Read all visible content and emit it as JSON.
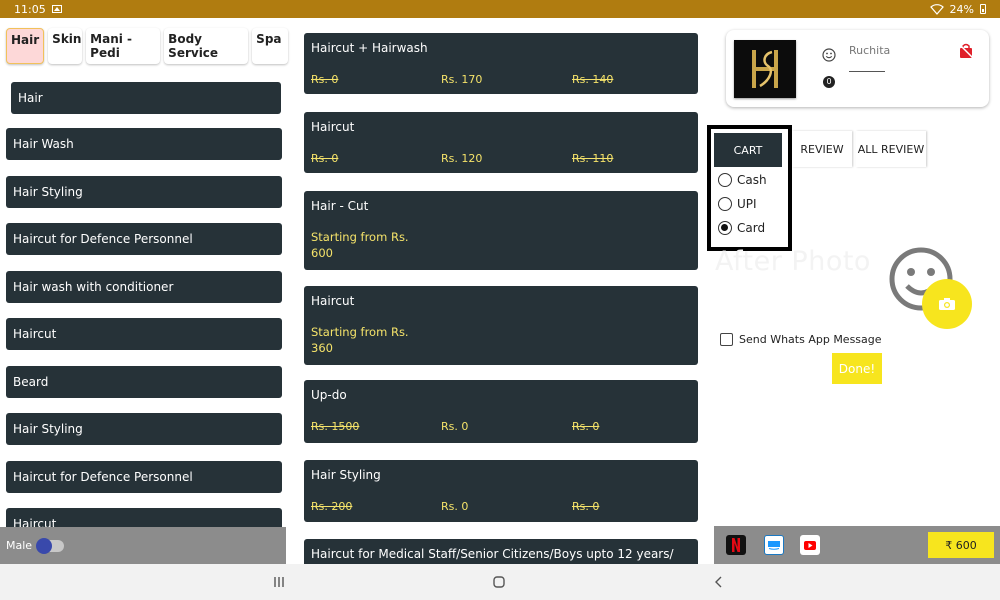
{
  "status": {
    "time": "11:05",
    "battery": "24%"
  },
  "categories": [
    "Hair",
    "Skin",
    "Mani - Pedi",
    "Body Service",
    "Spa"
  ],
  "services": [
    "Hair",
    "Hair Wash",
    "Hair Styling",
    "Haircut for Defence Personnel",
    "Hair wash with conditioner",
    "Haircut",
    "Beard",
    "Hair Styling",
    "Haircut for Defence Personnel",
    "Haircut"
  ],
  "gender_label": "Male",
  "cards": [
    {
      "title": "Haircut + Hairwash",
      "p1": "Rs. 0",
      "p2": "Rs. 170",
      "p3": "Rs. 140"
    },
    {
      "title": "Haircut",
      "p1": "Rs. 0",
      "p2": "Rs. 120",
      "p3": "Rs. 110"
    },
    {
      "title": "Hair - Cut",
      "from": "Starting from Rs.",
      "amount": "600"
    },
    {
      "title": "Haircut",
      "from": "Starting from Rs.",
      "amount": "360"
    },
    {
      "title": "Up-do",
      "p1": "Rs. 1500",
      "p2": "Rs. 0",
      "p3": "Rs. 0"
    },
    {
      "title": "Hair Styling",
      "p1": "Rs. 200",
      "p2": "Rs. 0",
      "p3": "Rs. 0"
    },
    {
      "title": "Haircut for Medical Staff/Senior Citizens/Boys upto 12 years/"
    }
  ],
  "profile": {
    "name": "Ruchita",
    "count": "0"
  },
  "tabs": {
    "cart": "CART",
    "review": "REVIEW",
    "all_review": "ALL REVIEW"
  },
  "payment": {
    "options": [
      "Cash",
      "UPI",
      "Card"
    ],
    "selected": "Card"
  },
  "after_photo": "After Photo",
  "whatsapp_label": "Send Whats App Message",
  "done_label": "Done!",
  "total": "₹ 600",
  "colors": {
    "dark": "#263238",
    "accent": "#f7e51e",
    "status": "#b07c10",
    "price": "#f5e36a"
  }
}
